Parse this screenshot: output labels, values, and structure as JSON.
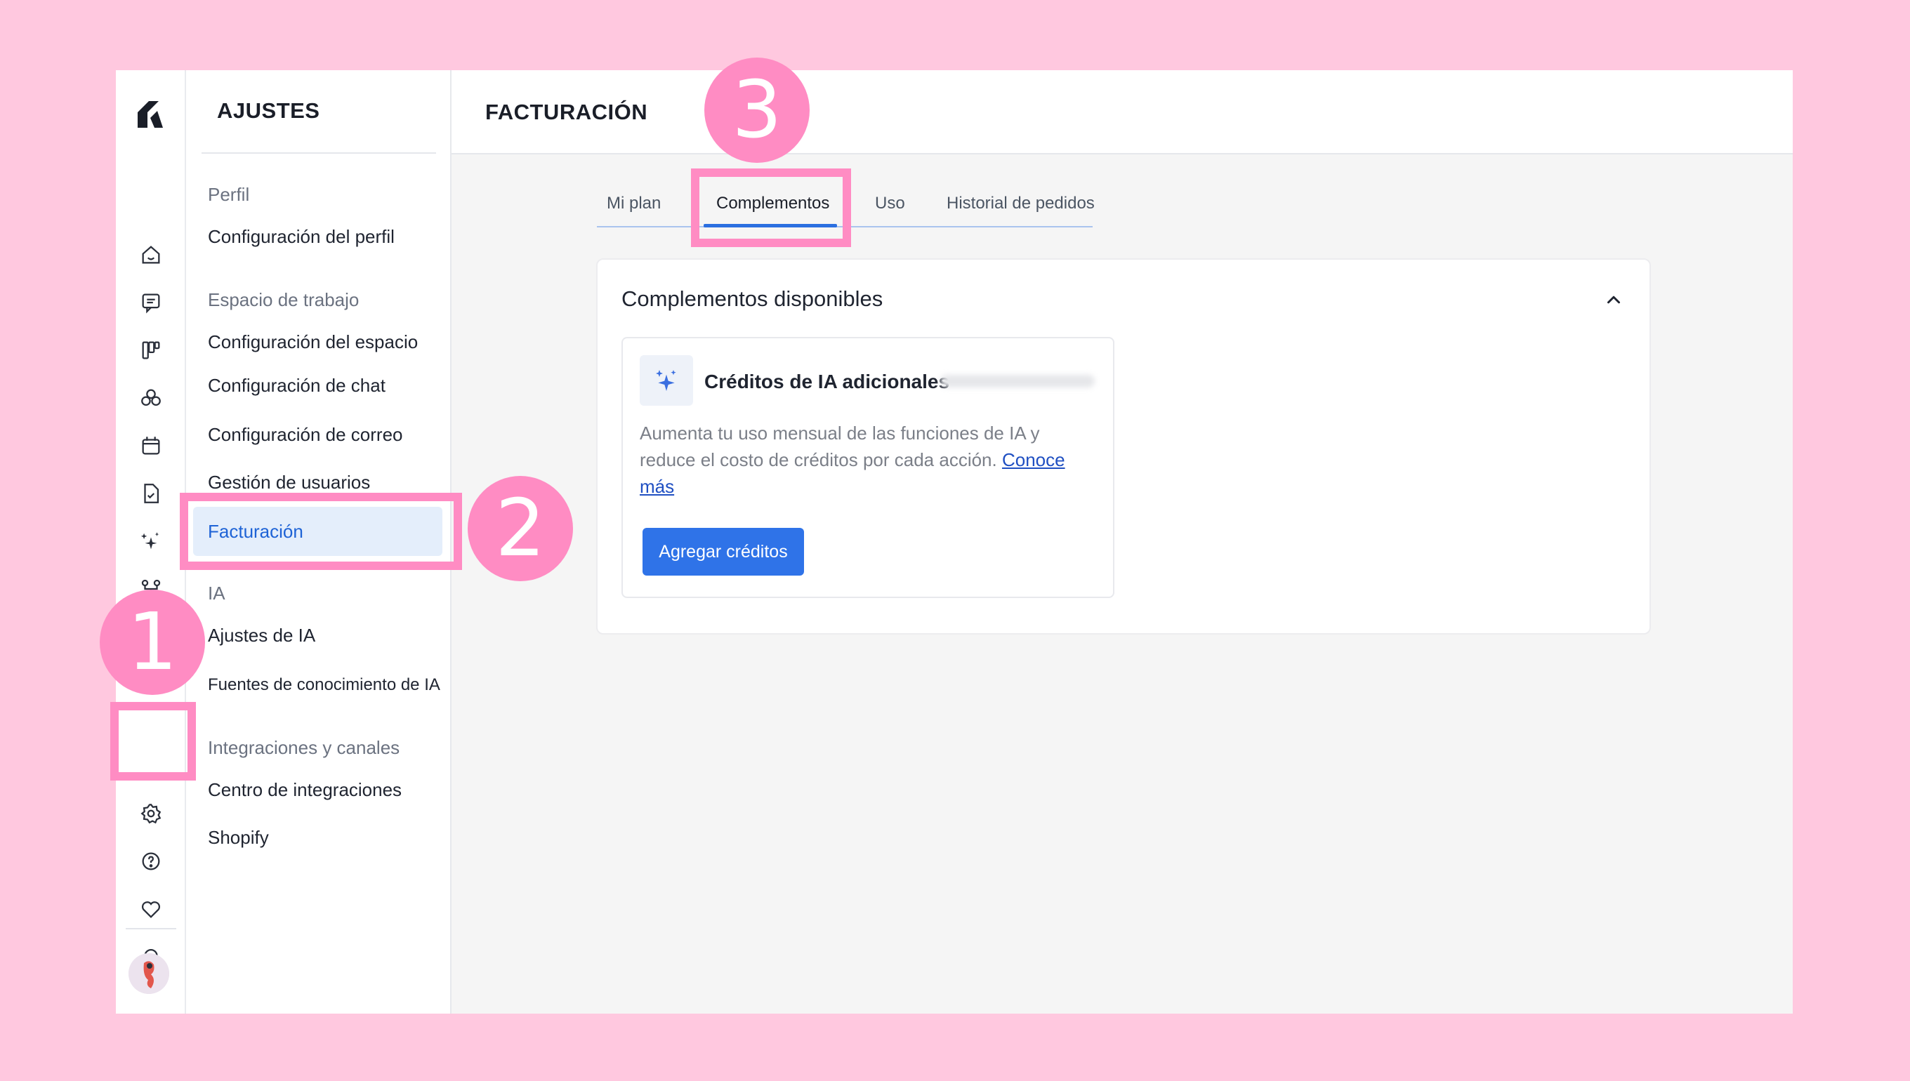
{
  "settings": {
    "title": "AJUSTES",
    "groups": {
      "profile": "Perfil",
      "workspace": "Espacio de trabajo",
      "ai": "IA",
      "integrations": "Integraciones y canales"
    },
    "items": {
      "profile_config": "Configuración del perfil",
      "space_config": "Configuración del espacio",
      "chat_config": "Configuración de chat",
      "mail_config": "Configuración de correo",
      "user_mgmt": "Gestión de usuarios",
      "billing": "Facturación",
      "ai_settings": "Ajustes de IA",
      "ai_sources": "Fuentes de conocimiento de IA",
      "integration_center": "Centro de integraciones",
      "shopify": "Shopify"
    }
  },
  "page": {
    "title": "FACTURACIÓN",
    "tabs": [
      "Mi plan",
      "Complementos",
      "Uso",
      "Historial de pedidos"
    ]
  },
  "panel": {
    "title": "Complementos disponibles",
    "card": {
      "title": "Créditos de IA adicionales",
      "description": "Aumenta tu uso mensual de las funciones de IA y reduce el costo de créditos por cada acción. ",
      "link": "Conoce más",
      "button": "Agregar créditos"
    }
  },
  "overlay": {
    "badges": [
      "1",
      "2",
      "3"
    ],
    "color": "#ff8cc3"
  },
  "colors": {
    "background": "#ffc8df",
    "accent": "#2f73e8",
    "active_bg": "#e4eefb"
  }
}
